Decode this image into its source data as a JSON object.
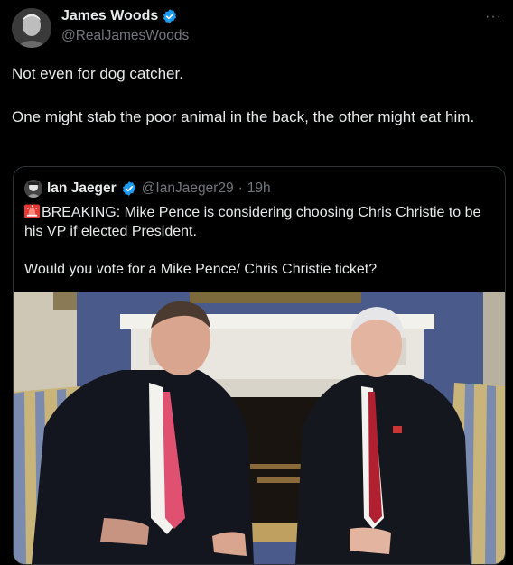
{
  "post": {
    "author": {
      "display_name": "James Woods",
      "handle": "@RealJamesWoods",
      "verified": true,
      "avatar_icon": "profile-photo"
    },
    "more_icon": "more-horizontal-icon",
    "more_label": "···",
    "text": [
      "Not even for dog catcher.",
      "One might stab the poor animal in the back, the other might eat him."
    ]
  },
  "quote": {
    "author": {
      "display_name": "Ian Jaeger",
      "handle": "@IanJaeger29",
      "separator": "·",
      "timestamp": "19h",
      "verified": true
    },
    "text": [
      "BREAKING: Mike Pence is considering choosing Chris Christie to be his VP if elected President.",
      "Would you vote for a Mike Pence/ Chris Christie ticket?"
    ],
    "leading_emoji": "siren-icon",
    "media": {
      "kind": "photo",
      "subject": "Two men in dark suits seated in front of a white fireplace"
    }
  },
  "colors": {
    "background": "#000000",
    "text_primary": "#e7e9ea",
    "text_secondary": "#71767b",
    "verified_blue": "#1d9bf0",
    "border": "#2f3336"
  }
}
